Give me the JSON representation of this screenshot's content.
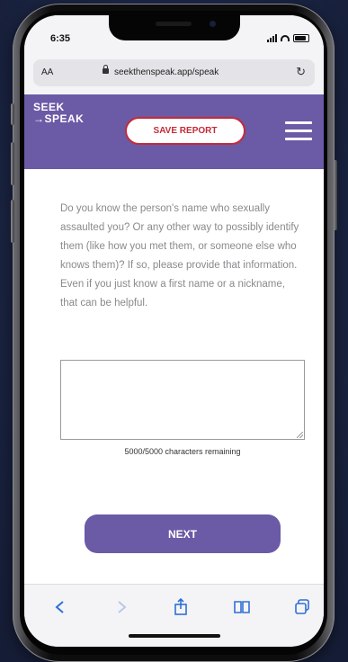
{
  "status_bar": {
    "time": "6:35"
  },
  "browser": {
    "text_size_label": "AA",
    "url": "seekthenspeak.app/speak",
    "reload_icon": "reload-icon"
  },
  "app": {
    "logo_line1": "SEEK",
    "logo_line2": "→SPEAK",
    "save_report_label": "SAVE REPORT",
    "menu_icon": "hamburger-menu-icon",
    "brand_color": "#6b5aa6",
    "save_color": "#c42a38"
  },
  "form": {
    "question": "Do you know the person's name who sexually assaulted you? Or any other way to possibly identify them (like how you met them, or someone else who knows them)? If so, please provide that information. Even if you just know a first name or a nickname, that can be helpful.",
    "response_value": "",
    "chars_remaining": "5000/5000 characters remaining",
    "next_label": "NEXT"
  },
  "toolbar": {
    "icons": [
      "back-icon",
      "forward-icon",
      "share-icon",
      "bookmarks-icon",
      "tabs-icon"
    ]
  }
}
